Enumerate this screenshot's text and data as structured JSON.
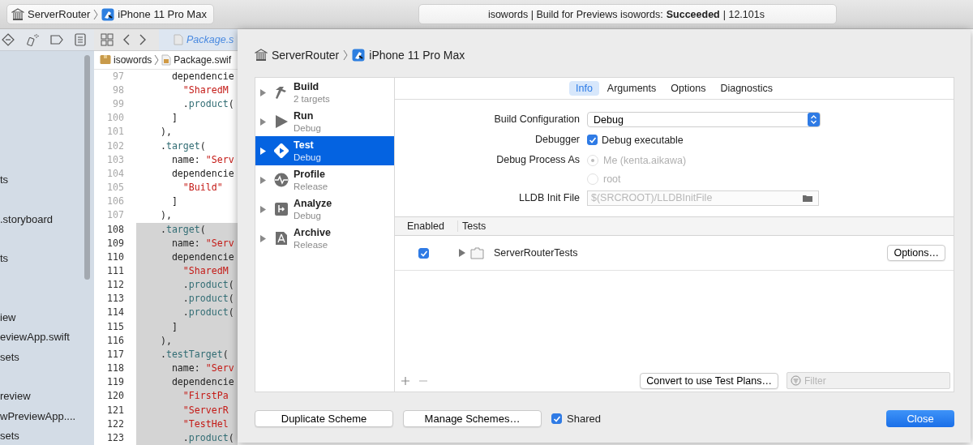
{
  "toolbar": {
    "scheme": {
      "project": "ServerRouter",
      "device": "iPhone 11 Pro Max"
    },
    "activity": "isowords | Build for Previews isowords: **Succeeded** | 12.101s"
  },
  "navigator": {
    "items": [
      {
        "name": "ts"
      },
      {
        "name": ".storyboard"
      },
      {
        "name": "ts"
      },
      {
        "name": "iew"
      },
      {
        "name": "eviewApp.swift"
      },
      {
        "name": "sets"
      },
      {
        "name": "review"
      },
      {
        "name": "wPreviewApp...."
      },
      {
        "name": "sets"
      }
    ]
  },
  "editor": {
    "tab": "Package.s",
    "breadcrumb": [
      "isowords",
      "Package.swif"
    ],
    "lines": [
      {
        "number": "97",
        "code": "      dependencie",
        "highlighted": false
      },
      {
        "number": "98",
        "code": "        \"SharedM",
        "highlighted": false
      },
      {
        "number": "99",
        "code": "        .product(",
        "highlighted": false
      },
      {
        "number": "100",
        "code": "      ]",
        "highlighted": false
      },
      {
        "number": "101",
        "code": "    ),",
        "highlighted": false
      },
      {
        "number": "102",
        "code": "    .target(",
        "highlighted": false
      },
      {
        "number": "103",
        "code": "      name: \"Serv",
        "highlighted": false
      },
      {
        "number": "104",
        "code": "      dependencie",
        "highlighted": false
      },
      {
        "number": "105",
        "code": "        \"Build\"",
        "highlighted": false
      },
      {
        "number": "106",
        "code": "      ]",
        "highlighted": false
      },
      {
        "number": "107",
        "code": "    ),",
        "highlighted": false
      },
      {
        "number": "108",
        "code": "    .target(",
        "highlighted": true
      },
      {
        "number": "109",
        "code": "      name: \"Serv",
        "highlighted": true
      },
      {
        "number": "110",
        "code": "      dependencie",
        "highlighted": true
      },
      {
        "number": "111",
        "code": "        \"SharedM",
        "highlighted": true
      },
      {
        "number": "112",
        "code": "        .product(",
        "highlighted": true
      },
      {
        "number": "113",
        "code": "        .product(",
        "highlighted": true
      },
      {
        "number": "114",
        "code": "        .product(",
        "highlighted": true
      },
      {
        "number": "115",
        "code": "      ]",
        "highlighted": true
      },
      {
        "number": "116",
        "code": "    ),",
        "highlighted": true
      },
      {
        "number": "117",
        "code": "    .testTarget(",
        "highlighted": true
      },
      {
        "number": "118",
        "code": "      name: \"Serv",
        "highlighted": true
      },
      {
        "number": "119",
        "code": "      dependencie",
        "highlighted": true
      },
      {
        "number": "120",
        "code": "        \"FirstPa",
        "highlighted": true
      },
      {
        "number": "121",
        "code": "        \"ServerR",
        "highlighted": true
      },
      {
        "number": "122",
        "code": "        \"TestHel",
        "highlighted": true
      },
      {
        "number": "123",
        "code": "        .product(",
        "highlighted": true
      }
    ]
  },
  "sheet": {
    "title": {
      "project": "ServerRouter",
      "device": "iPhone 11 Pro Max"
    },
    "actions": [
      {
        "kind": "build",
        "name": "Build",
        "detail": "2 targets",
        "selected": false
      },
      {
        "kind": "run",
        "name": "Run",
        "detail": "Debug",
        "selected": false
      },
      {
        "kind": "test",
        "name": "Test",
        "detail": "Debug",
        "selected": true
      },
      {
        "kind": "profile",
        "name": "Profile",
        "detail": "Release",
        "selected": false
      },
      {
        "kind": "analyze",
        "name": "Analyze",
        "detail": "Debug",
        "selected": false
      },
      {
        "kind": "archive",
        "name": "Archive",
        "detail": "Release",
        "selected": false
      }
    ],
    "tabs": [
      {
        "label": "Info",
        "selected": true
      },
      {
        "label": "Arguments",
        "selected": false
      },
      {
        "label": "Options",
        "selected": false
      },
      {
        "label": "Diagnostics",
        "selected": false
      }
    ],
    "form": [
      {
        "kind": "popup",
        "label": "Build Configuration",
        "value": "Debug"
      },
      {
        "kind": "checkbox",
        "label": "Debugger",
        "text": "Debug executable",
        "checked": true
      },
      {
        "kind": "radio",
        "label": "Debug Process As",
        "disabled": true,
        "options": [
          {
            "text": "Me (kenta.aikawa)",
            "selected": true
          },
          {
            "text": "root",
            "selected": false
          }
        ]
      },
      {
        "kind": "path",
        "label": "LLDB Init File",
        "placeholder": "$(SRCROOT)/LLDBInitFile"
      }
    ],
    "tests": {
      "columns": [
        "Enabled",
        "Tests"
      ],
      "rows": [
        {
          "enabled": true,
          "expanded": false,
          "name": "ServerRouterTests",
          "button": "Options…"
        }
      ],
      "convert_button": "Convert to use Test Plans…",
      "filter": {
        "placeholder": "Filter"
      }
    },
    "duplicate_button": "Duplicate Scheme",
    "manage_button": "Manage Schemes…",
    "shared": {
      "label": "Shared",
      "checked": true
    },
    "close_button": "Close"
  }
}
